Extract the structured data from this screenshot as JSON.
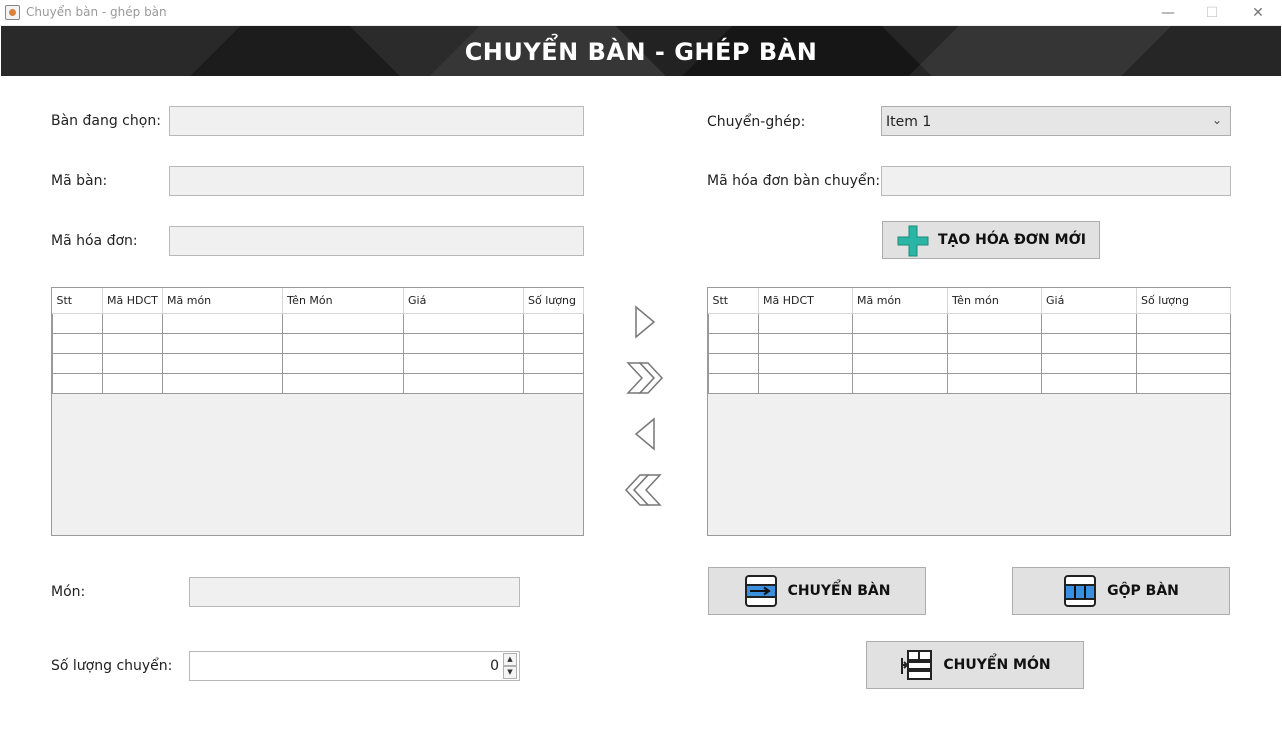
{
  "window": {
    "title": "Chuyển bàn - ghép bàn",
    "minimize": "—",
    "maximize": "☐",
    "close": "✕"
  },
  "banner": {
    "title": "CHUYỂN BÀN - GHÉP BÀN"
  },
  "left": {
    "ban_dang_chon_label": "Bàn đang chọn:",
    "ma_ban_label": "Mã bàn:",
    "ma_hoa_don_label": "Mã hóa đơn:",
    "table": {
      "columns": [
        "Stt",
        "Mã HDCT",
        "Mã món",
        "Tên Món",
        "Giá",
        "Số lượng"
      ],
      "rows": 4
    },
    "mon_label": "Món:",
    "so_luong_label": "Số lượng chuyển:",
    "so_luong_value": "0"
  },
  "right": {
    "chuyen_ghep_label": "Chuyển-ghép:",
    "chuyen_ghep_selected": "Item 1",
    "ma_hoa_don_chuyen_label": "Mã hóa đơn bàn chuyển:",
    "tao_hoa_don_button": "TẠO HÓA ĐƠN MỚI",
    "table": {
      "columns": [
        "Stt",
        "Mã HDCT",
        "Mã món",
        "Tên món",
        "Giá",
        "Số lượng"
      ],
      "rows": 4
    },
    "chuyen_ban_button": "CHUYỂN BÀN",
    "gop_ban_button": "GỘP BÀN",
    "chuyen_mon_button": "CHUYỂN MÓN"
  },
  "colors": {
    "accent_teal": "#2bb5a4",
    "accent_blue": "#3b8fe0",
    "banner_bg": "#1e1e1e"
  }
}
